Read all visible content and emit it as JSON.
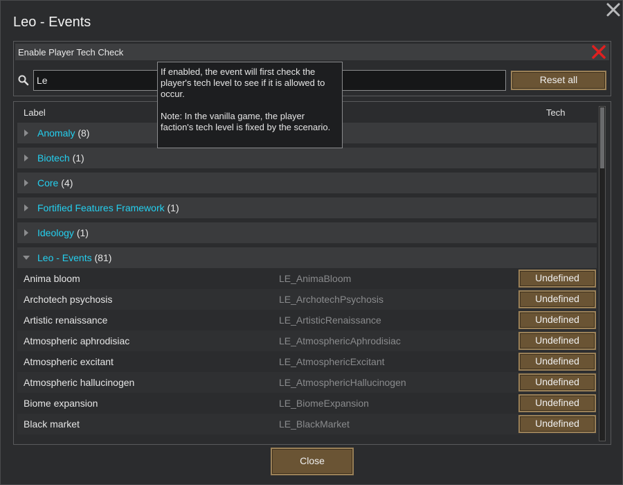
{
  "window": {
    "title": "Leo - Events"
  },
  "toggle": {
    "label": "Enable Player Tech Check",
    "checked": false
  },
  "search": {
    "value": "Le",
    "reset_label": "Reset all"
  },
  "tooltip": {
    "text": "If enabled, the event will first check the player's tech level to see if it is allowed to occur.\n\nNote: In the vanilla game, the player faction's tech level is fixed by the scenario."
  },
  "list": {
    "columns": {
      "label": "Label",
      "tech": "Tech"
    },
    "groups": [
      {
        "name": "Anomaly",
        "count": "(8)",
        "expanded": false
      },
      {
        "name": "Biotech",
        "count": "(1)",
        "expanded": false
      },
      {
        "name": "Core",
        "count": "(4)",
        "expanded": false
      },
      {
        "name": "Fortified Features Framework",
        "count": "(1)",
        "expanded": false
      },
      {
        "name": "Ideology",
        "count": "(1)",
        "expanded": false
      },
      {
        "name": "Leo - Events",
        "count": "(81)",
        "expanded": true
      }
    ],
    "rows": [
      {
        "label": "Anima bloom",
        "def": "LE_AnimaBloom",
        "tech": "Undefined"
      },
      {
        "label": "Archotech psychosis",
        "def": "LE_ArchotechPsychosis",
        "tech": "Undefined"
      },
      {
        "label": "Artistic renaissance",
        "def": "LE_ArtisticRenaissance",
        "tech": "Undefined"
      },
      {
        "label": "Atmospheric aphrodisiac",
        "def": "LE_AtmosphericAphrodisiac",
        "tech": "Undefined"
      },
      {
        "label": "Atmospheric excitant",
        "def": "LE_AtmosphericExcitant",
        "tech": "Undefined"
      },
      {
        "label": "Atmospheric hallucinogen",
        "def": "LE_AtmosphericHallucinogen",
        "tech": "Undefined"
      },
      {
        "label": "Biome expansion",
        "def": "LE_BiomeExpansion",
        "tech": "Undefined"
      },
      {
        "label": "Black market",
        "def": "LE_BlackMarket",
        "tech": "Undefined"
      }
    ]
  },
  "footer": {
    "close_label": "Close"
  },
  "colors": {
    "accent_text": "#24d0f0",
    "button_fill": "#6a5434",
    "button_border": "#9b8158",
    "toggle_x": "#e02020"
  }
}
